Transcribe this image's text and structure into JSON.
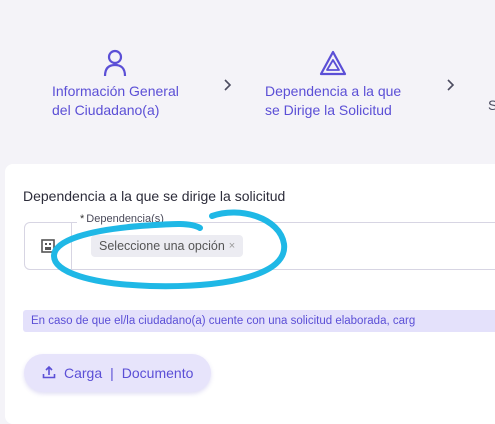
{
  "stepper": {
    "steps": [
      {
        "label": "Información General\ndel Ciudadano(a)",
        "icon": "user-icon"
      },
      {
        "label": "Dependencia a la que\nse Dirige la Solicitud",
        "icon": "triangle-icon"
      },
      {
        "label": "S",
        "icon": ""
      }
    ],
    "separator_icon": "chevron-right-icon"
  },
  "section": {
    "title": "Dependencia a la que se dirige la solicitud",
    "field": {
      "required_mark": "*",
      "label": "Dependencia(s)",
      "selected_chip": "Seleccione una opción",
      "chip_remove": "×",
      "prefix_icon": "building-icon"
    },
    "info_text": "En caso de que el/la ciudadano(a) cuente con una solicitud elaborada, carg",
    "upload_button": {
      "label_left": "Carga",
      "label_sep": "|",
      "label_right": "Documento",
      "icon": "upload-icon"
    }
  },
  "colors": {
    "accent": "#5b4fd6",
    "background": "#f4f3f8",
    "annotation": "#1fb8e6",
    "info_bg": "#e4e1fb"
  }
}
